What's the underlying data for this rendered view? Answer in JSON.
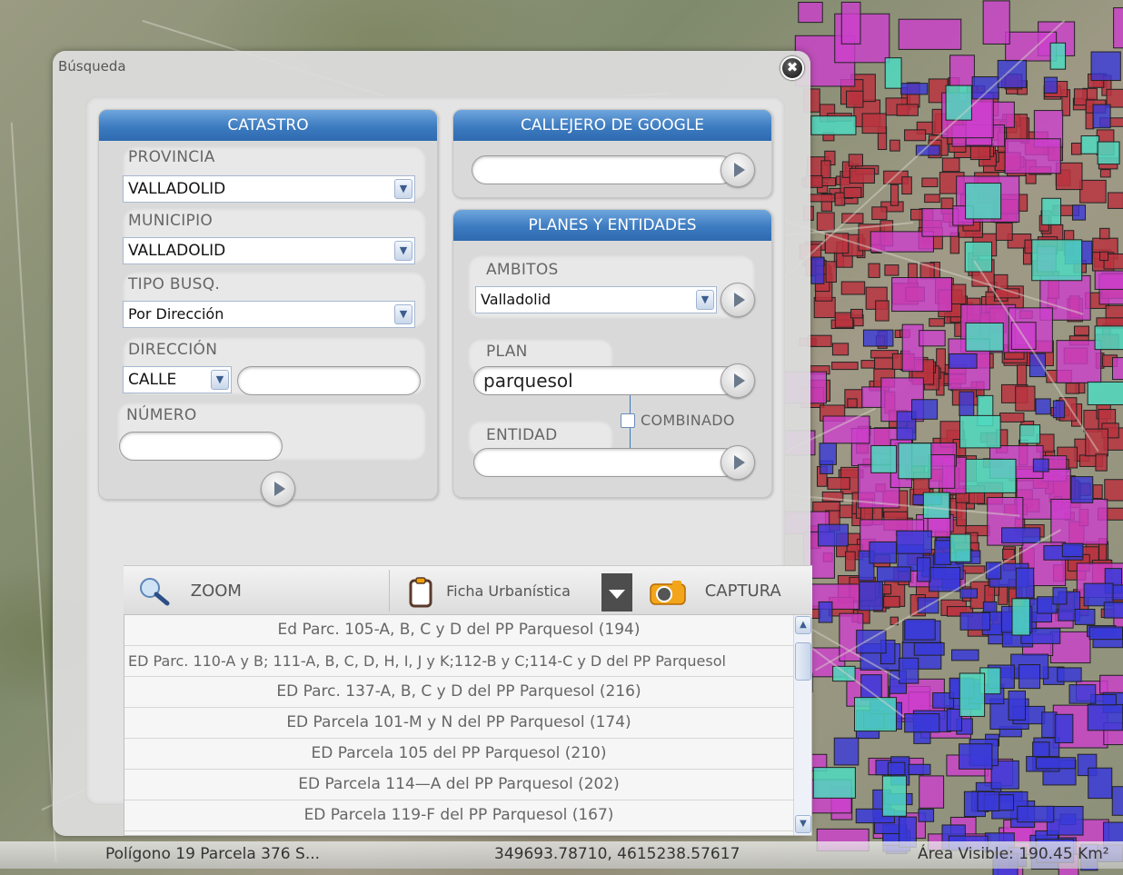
{
  "dialog": {
    "title": "Búsqueda",
    "close_icon": "✖"
  },
  "catastro": {
    "header": "CATASTRO",
    "provincia_label": "PROVINCIA",
    "provincia_value": "VALLADOLID",
    "municipio_label": "MUNICIPIO",
    "municipio_value": "VALLADOLID",
    "tipo_busq_label": "TIPO BUSQ.",
    "tipo_busq_value": "Por Dirección",
    "direccion_label": "DIRECCIÓN",
    "direccion_tipo_value": "CALLE",
    "direccion_value": "",
    "numero_label": "NÚMERO",
    "numero_value": ""
  },
  "google": {
    "header": "CALLEJERO DE GOOGLE",
    "search_value": ""
  },
  "planes": {
    "header": "PLANES Y ENTIDADES",
    "ambitos_label": "AMBITOS",
    "ambitos_value": "Valladolid",
    "plan_label": "PLAN",
    "plan_value": "parquesol",
    "combinado_label": "COMBINADO",
    "combinado_checked": false,
    "entidad_label": "ENTIDAD",
    "entidad_value": ""
  },
  "toolbar": {
    "zoom_label": "ZOOM",
    "ficha_label": "Ficha Urbanística",
    "captura_label": "CAPTURA"
  },
  "results": [
    "Ed Parc. 105-A, B, C y D del PP Parquesol (194)",
    "ED Parc. 110-A y B; 111-A, B, C, D, H, I, J y K;112-B y C;114-C y D del PP Parquesol",
    "ED Parc. 137-A, B, C y D del PP Parquesol (216)",
    "ED Parcela 101-M y N del PP Parquesol (174)",
    "ED Parcela 105 del PP Parquesol (210)",
    "ED Parcela 114—A del PP Parquesol (202)",
    "ED Parcela 119-F del PP Parquesol (167)"
  ],
  "status": {
    "parcel": "Polígono 19 Parcela 376 S...",
    "coords": "349693.78710, 4615238.57617",
    "area": "Área Visible: 190.45 Km²"
  },
  "colors": {
    "header_blue": "#3d7bc0",
    "map_red": "#b8343f",
    "map_magenta": "#cc3fcc",
    "map_blue": "#3a3ad8",
    "map_cyan": "#4fd9c0"
  }
}
